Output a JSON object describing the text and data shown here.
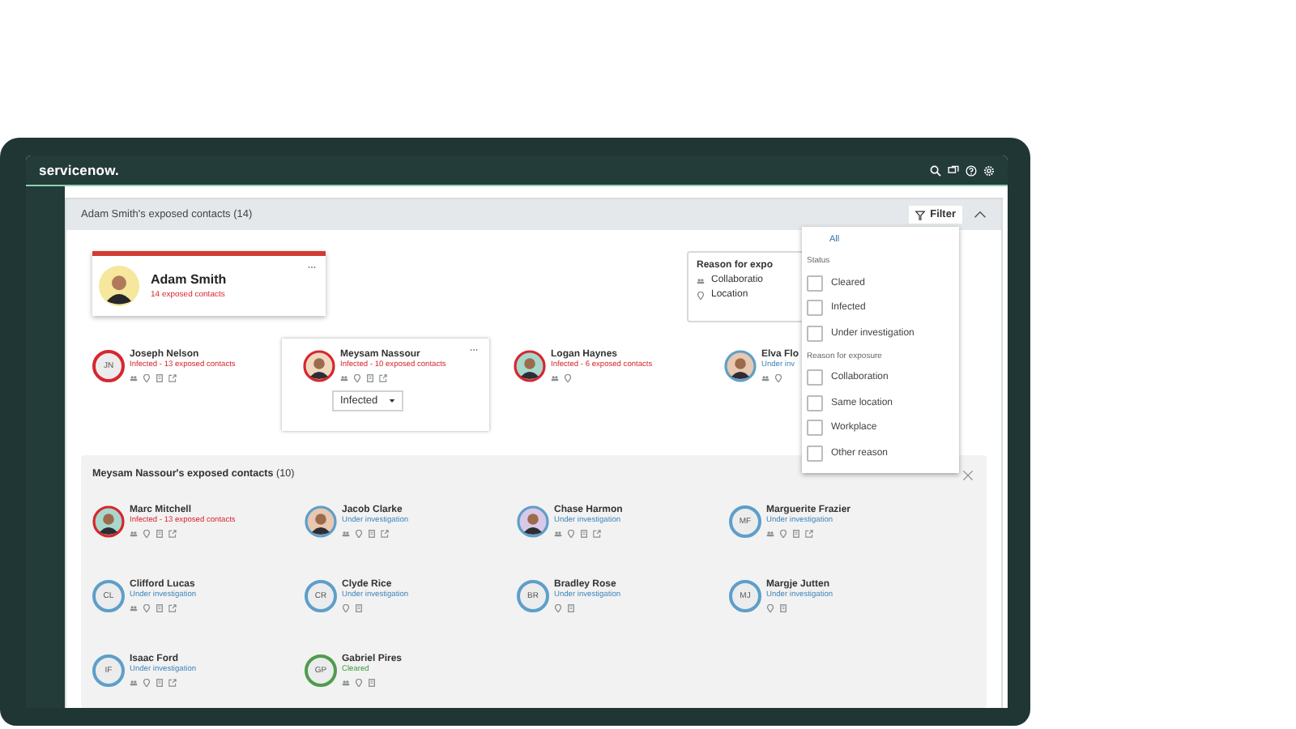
{
  "app": {
    "logo": "servicenow."
  },
  "panel": {
    "title": "Adam Smith's exposed contacts (14)",
    "filter_label": "Filter"
  },
  "focus": {
    "name": "Adam Smith",
    "subtitle": "14 exposed contacts"
  },
  "legend": {
    "title": "Reason for expo",
    "items": [
      {
        "kind": "collaboration",
        "label": "Collaboratio"
      },
      {
        "kind": "location",
        "label": "Location"
      }
    ]
  },
  "contacts": [
    {
      "name": "Joseph Nelson",
      "kind": "infected",
      "status_text": "Infected - 13 exposed contacts",
      "avatar": {
        "kind": "initials",
        "initials": "JN"
      },
      "reasons": [
        {
          "kind": "collaboration"
        },
        {
          "kind": "location"
        },
        {
          "kind": "workplace"
        },
        {
          "kind": "external"
        }
      ],
      "selected": false
    },
    {
      "name": "Meysam Nassour",
      "kind": "infected",
      "status_text": "Infected - 10 exposed contacts",
      "avatar": {
        "kind": "picture"
      },
      "reasons": [
        {
          "kind": "collaboration"
        },
        {
          "kind": "location"
        },
        {
          "kind": "workplace"
        },
        {
          "kind": "external"
        }
      ],
      "selected": true,
      "dropdown": "Infected"
    },
    {
      "name": "Logan Haynes",
      "kind": "infected",
      "status_text": "Infected - 6 exposed contacts",
      "avatar": {
        "kind": "picture"
      },
      "reasons": [
        {
          "kind": "collaboration"
        },
        {
          "kind": "location"
        }
      ],
      "selected": false
    },
    {
      "name": "Elva Flo",
      "kind": "investigating",
      "status_text": "Under inv",
      "avatar": {
        "kind": "picture"
      },
      "reasons": [
        {
          "kind": "collaboration"
        },
        {
          "kind": "location"
        }
      ],
      "selected": false
    }
  ],
  "subpanel": {
    "title": "**Meysam Nassour's exposed contacts** (10)",
    "contacts": [
      {
        "name": "Marc Mitchell",
        "kind": "infected",
        "status_text": "Infected - 13 exposed contacts",
        "avatar": {
          "kind": "picture"
        },
        "reasons": [
          {
            "kind": "collaboration"
          },
          {
            "kind": "location"
          },
          {
            "kind": "workplace"
          },
          {
            "kind": "external"
          }
        ]
      },
      {
        "name": "Jacob Clarke",
        "kind": "investigating",
        "status_text": "Under investigation",
        "avatar": {
          "kind": "picture"
        },
        "reasons": [
          {
            "kind": "collaboration"
          },
          {
            "kind": "location"
          },
          {
            "kind": "workplace"
          },
          {
            "kind": "external"
          }
        ]
      },
      {
        "name": "Chase Harmon",
        "kind": "investigating",
        "status_text": "Under investigation",
        "avatar": {
          "kind": "picture"
        },
        "reasons": [
          {
            "kind": "collaboration"
          },
          {
            "kind": "location"
          },
          {
            "kind": "workplace"
          },
          {
            "kind": "external"
          }
        ]
      },
      {
        "name": "Marguerite Frazier",
        "kind": "investigating",
        "status_text": "Under investigation",
        "avatar": {
          "kind": "initials",
          "initials": "MF"
        },
        "reasons": [
          {
            "kind": "collaboration"
          },
          {
            "kind": "location"
          },
          {
            "kind": "workplace"
          },
          {
            "kind": "external"
          }
        ]
      },
      {
        "name": "Clifford Lucas",
        "kind": "investigating",
        "status_text": "Under investigation",
        "avatar": {
          "kind": "initials",
          "initials": "CL"
        },
        "reasons": [
          {
            "kind": "collaboration"
          },
          {
            "kind": "location"
          },
          {
            "kind": "workplace"
          },
          {
            "kind": "external"
          }
        ]
      },
      {
        "name": "Clyde Rice",
        "kind": "investigating",
        "status_text": "Under investigation",
        "avatar": {
          "kind": "initials",
          "initials": "CR"
        },
        "reasons": [
          {
            "kind": "location"
          },
          {
            "kind": "workplace"
          }
        ]
      },
      {
        "name": "Bradley Rose",
        "kind": "investigating",
        "status_text": "Under investigation",
        "avatar": {
          "kind": "initials",
          "initials": "BR"
        },
        "reasons": [
          {
            "kind": "location"
          },
          {
            "kind": "workplace"
          }
        ]
      },
      {
        "name": "Margje Jutten",
        "kind": "investigating",
        "status_text": "Under investigation",
        "avatar": {
          "kind": "initials",
          "initials": "MJ"
        },
        "reasons": [
          {
            "kind": "location"
          },
          {
            "kind": "workplace"
          }
        ]
      },
      {
        "name": "Isaac Ford",
        "kind": "investigating",
        "status_text": "Under investigation",
        "avatar": {
          "kind": "initials",
          "initials": "IF"
        },
        "reasons": [
          {
            "kind": "collaboration"
          },
          {
            "kind": "location"
          },
          {
            "kind": "workplace"
          },
          {
            "kind": "external"
          }
        ]
      },
      {
        "name": "Gabriel Pires",
        "kind": "cleared",
        "status_text": "Cleared",
        "avatar": {
          "kind": "initials",
          "initials": "GP"
        },
        "reasons": [
          {
            "kind": "collaboration"
          },
          {
            "kind": "location"
          },
          {
            "kind": "workplace"
          }
        ]
      }
    ]
  },
  "filter_menu": {
    "all": "All",
    "groups": [
      {
        "heading": "Status",
        "options": [
          {
            "label": "Cleared",
            "checked": false
          },
          {
            "label": "Infected",
            "checked": false
          },
          {
            "label": "Under investigation",
            "checked": false
          }
        ]
      },
      {
        "heading": "Reason for exposure",
        "options": [
          {
            "label": "Collaboration",
            "checked": false
          },
          {
            "label": "Same location",
            "checked": false
          },
          {
            "label": "Workplace",
            "checked": false
          },
          {
            "label": "Other reason",
            "checked": false
          }
        ]
      }
    ]
  }
}
